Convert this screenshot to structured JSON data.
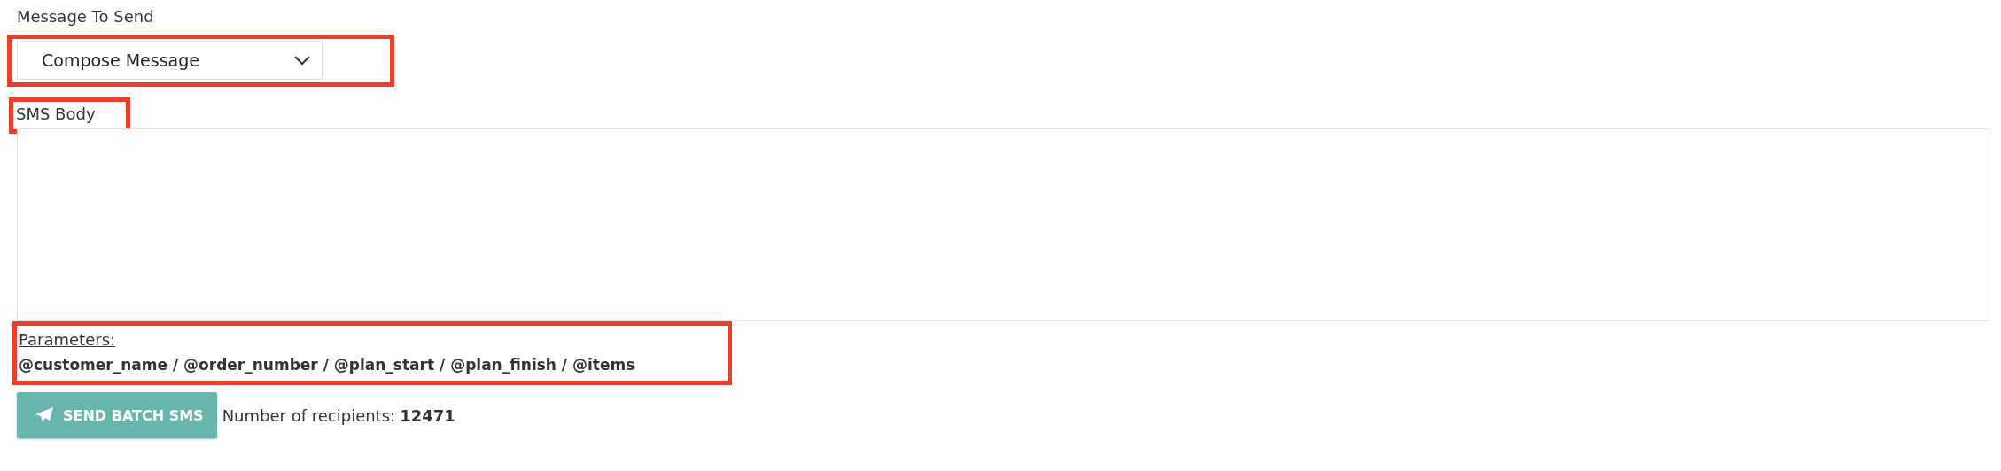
{
  "message_select": {
    "label": "Message To Send",
    "value": "Compose Message",
    "highlighted": true
  },
  "sms_body": {
    "label": "SMS Body",
    "highlighted": true
  },
  "parameters": {
    "label": "Parameters:",
    "list": "@customer_name / @order_number / @plan_start / @plan_finish / @items",
    "highlighted": true
  },
  "send_button": {
    "label": "SEND BATCH SMS"
  },
  "recipients": {
    "label": "Number of recipients:",
    "count": "12471"
  }
}
